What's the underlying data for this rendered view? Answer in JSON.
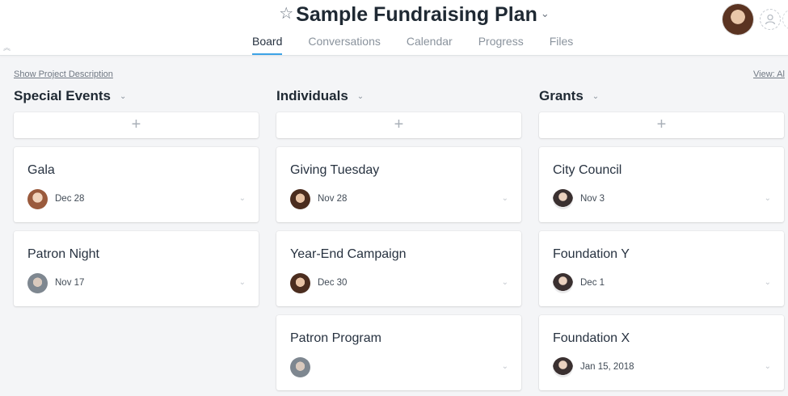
{
  "project": {
    "title": "Sample Fundraising Plan",
    "star_icon": "star-icon",
    "caret": "⌄"
  },
  "tabs": [
    {
      "label": "Board",
      "active": true
    },
    {
      "label": "Conversations",
      "active": false
    },
    {
      "label": "Calendar",
      "active": false
    },
    {
      "label": "Progress",
      "active": false
    },
    {
      "label": "Files",
      "active": false
    }
  ],
  "links": {
    "show_description": "Show Project Description",
    "view_all": "View: Al"
  },
  "columns": [
    {
      "title": "Special Events",
      "cards": [
        {
          "title": "Gala",
          "date": "Dec 28"
        },
        {
          "title": "Patron Night",
          "date": "Nov 17"
        }
      ]
    },
    {
      "title": "Individuals",
      "cards": [
        {
          "title": "Giving Tuesday",
          "date": "Nov 28"
        },
        {
          "title": "Year-End Campaign",
          "date": "Dec 30"
        },
        {
          "title": "Patron Program",
          "date": ""
        }
      ]
    },
    {
      "title": "Grants",
      "cards": [
        {
          "title": "City Council",
          "date": "Nov 3"
        },
        {
          "title": "Foundation Y",
          "date": "Dec 1"
        },
        {
          "title": "Foundation X",
          "date": "Jan 15, 2018"
        }
      ]
    }
  ],
  "icons": {
    "add": "+",
    "column_caret": "⌄",
    "card_chevron": "⌄",
    "collapse": "︽"
  },
  "colors": {
    "accent": "#3da3e6",
    "background": "#f4f5f7"
  }
}
